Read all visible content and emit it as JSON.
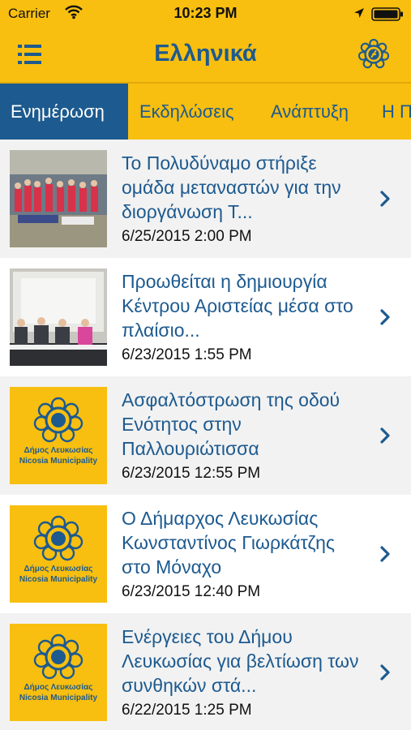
{
  "status_bar": {
    "carrier": "Carrier",
    "time": "10:23 PM"
  },
  "nav": {
    "title": "Ελληνικά",
    "menu_icon": "list-menu-icon",
    "logo_icon": "nicosia-municipality-logo-icon"
  },
  "tabs": [
    {
      "label": "Ενημέρωση",
      "active": true
    },
    {
      "label": "Εκδηλώσεις",
      "active": false
    },
    {
      "label": "Ανάπτυξη",
      "active": false
    },
    {
      "label": "Η Π",
      "active": false
    }
  ],
  "municipality": {
    "name_el": "Δήμος Λευκωσίας",
    "name_en": "Nicosia Municipality"
  },
  "news": [
    {
      "title": "Το Πολυδύναμο στήριξε ομάδα μεταναστών για την διοργάνωση Τ...",
      "date": "6/25/2015 2:00 PM",
      "thumb": "photo-team"
    },
    {
      "title": "Προωθείται η δημιουργία Κέντρου Αριστείας μέσα στο πλαίσιο...",
      "date": "6/23/2015 1:55 PM",
      "thumb": "photo-conference"
    },
    {
      "title": "Ασφαλτόστρωση της οδού Ενότητος στην Παλλουριώτισσα",
      "date": "6/23/2015 12:55 PM",
      "thumb": "municipality-logo"
    },
    {
      "title": "Ο Δήμαρχος Λευκωσίας Κωνσταντίνος Γιωρκάτζης στο Μόναχο",
      "date": "6/23/2015 12:40 PM",
      "thumb": "municipality-logo"
    },
    {
      "title": "Ενέργειες του Δήμου Λευκωσίας για βελτίωση των συνθηκών στά...",
      "date": "6/22/2015 1:25 PM",
      "thumb": "municipality-logo"
    }
  ],
  "colors": {
    "brand_yellow": "#f8bf10",
    "brand_blue": "#1d5a8f",
    "row_alt": "#f2f2f2"
  }
}
